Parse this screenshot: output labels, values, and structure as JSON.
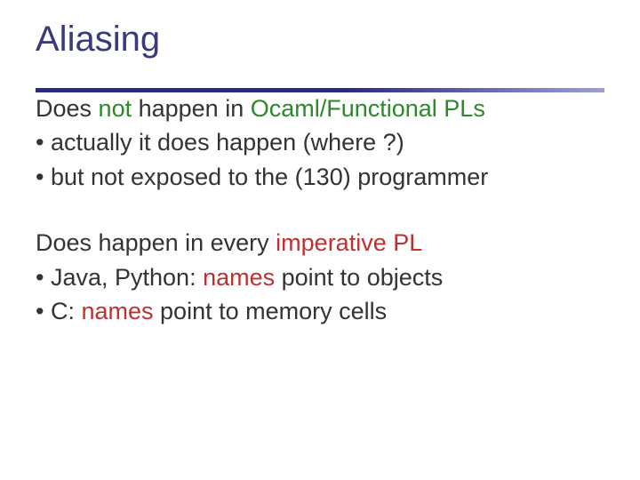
{
  "title": "Aliasing",
  "block1": {
    "lead_pre": "Does ",
    "lead_not": "not",
    "lead_post": " happen in ",
    "lead_lang": "Ocaml/Functional PLs",
    "b1": "actually it does happen (where ?)",
    "b2": "but not exposed to the (130) programmer"
  },
  "block2": {
    "lead_pre": "Does happen in every ",
    "lead_kind": "imperative PL",
    "b1_pre": "Java, Python: ",
    "b1_hl": "names",
    "b1_post": " point to objects",
    "b2_pre": "C: ",
    "b2_hl": "names",
    "b2_post": " point to memory cells"
  }
}
